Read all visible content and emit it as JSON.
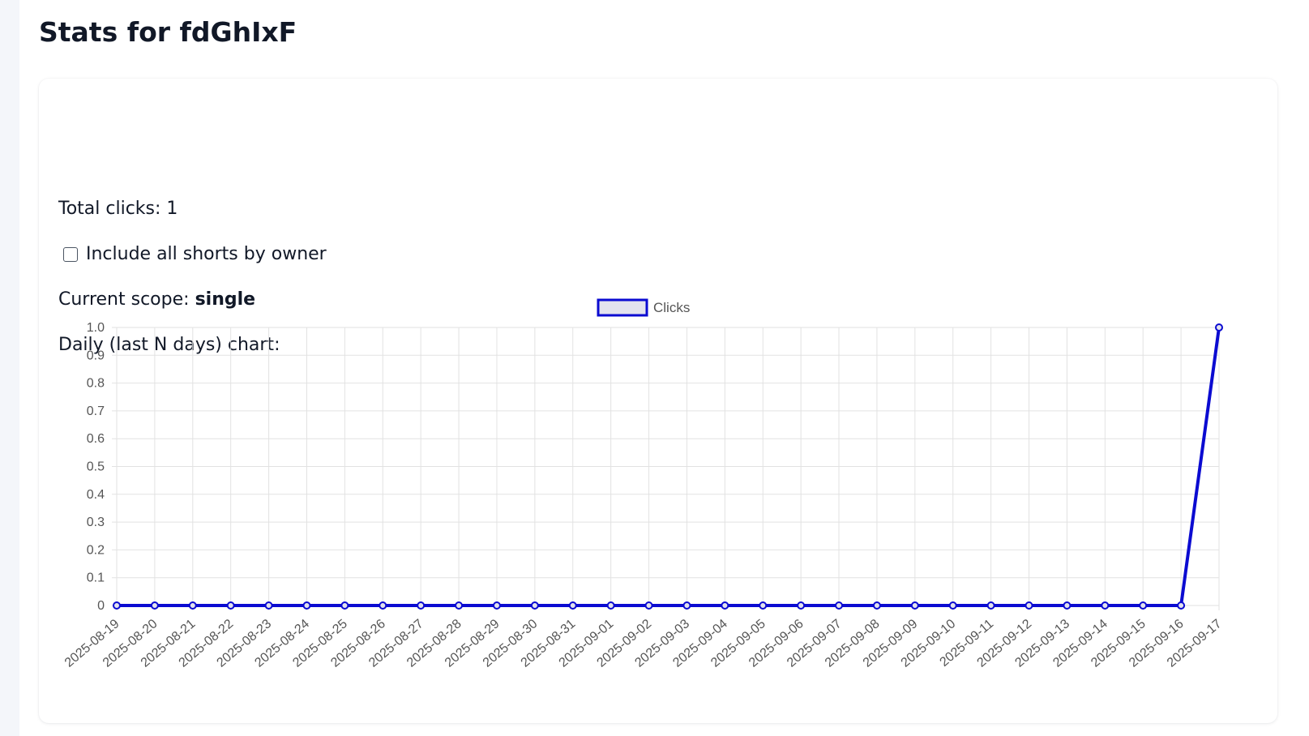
{
  "page": {
    "title": "Stats for fdGhIxF"
  },
  "stats": {
    "total_label": "Total clicks: 1",
    "include_label": "Include all shorts by owner",
    "include_checked": false,
    "scope_label": "Current scope:",
    "scope_value": "single",
    "chart_label": "Daily (last N days) chart:"
  },
  "colors": {
    "series_line": "#0b0bd1",
    "legend_fill": "#e3e3ee",
    "grid": "#e2e2e2",
    "tick_text": "#555555"
  },
  "chart_data": {
    "type": "line",
    "title": "",
    "xlabel": "",
    "ylabel": "",
    "ylim": [
      0,
      1.0
    ],
    "yticks": [
      "1.0",
      "0.9",
      "0.8",
      "0.7",
      "0.6",
      "0.5",
      "0.4",
      "0.3",
      "0.2",
      "0.1",
      "0"
    ],
    "legend_position": "top",
    "grid": true,
    "x": [
      "2025-08-19",
      "2025-08-20",
      "2025-08-21",
      "2025-08-22",
      "2025-08-23",
      "2025-08-24",
      "2025-08-25",
      "2025-08-26",
      "2025-08-27",
      "2025-08-28",
      "2025-08-29",
      "2025-08-30",
      "2025-08-31",
      "2025-09-01",
      "2025-09-02",
      "2025-09-03",
      "2025-09-04",
      "2025-09-05",
      "2025-09-06",
      "2025-09-07",
      "2025-09-08",
      "2025-09-09",
      "2025-09-10",
      "2025-09-11",
      "2025-09-12",
      "2025-09-13",
      "2025-09-14",
      "2025-09-15",
      "2025-09-16",
      "2025-09-17"
    ],
    "series": [
      {
        "name": "Clicks",
        "values": [
          0,
          0,
          0,
          0,
          0,
          0,
          0,
          0,
          0,
          0,
          0,
          0,
          0,
          0,
          0,
          0,
          0,
          0,
          0,
          0,
          0,
          0,
          0,
          0,
          0,
          0,
          0,
          0,
          0,
          1
        ]
      }
    ]
  }
}
